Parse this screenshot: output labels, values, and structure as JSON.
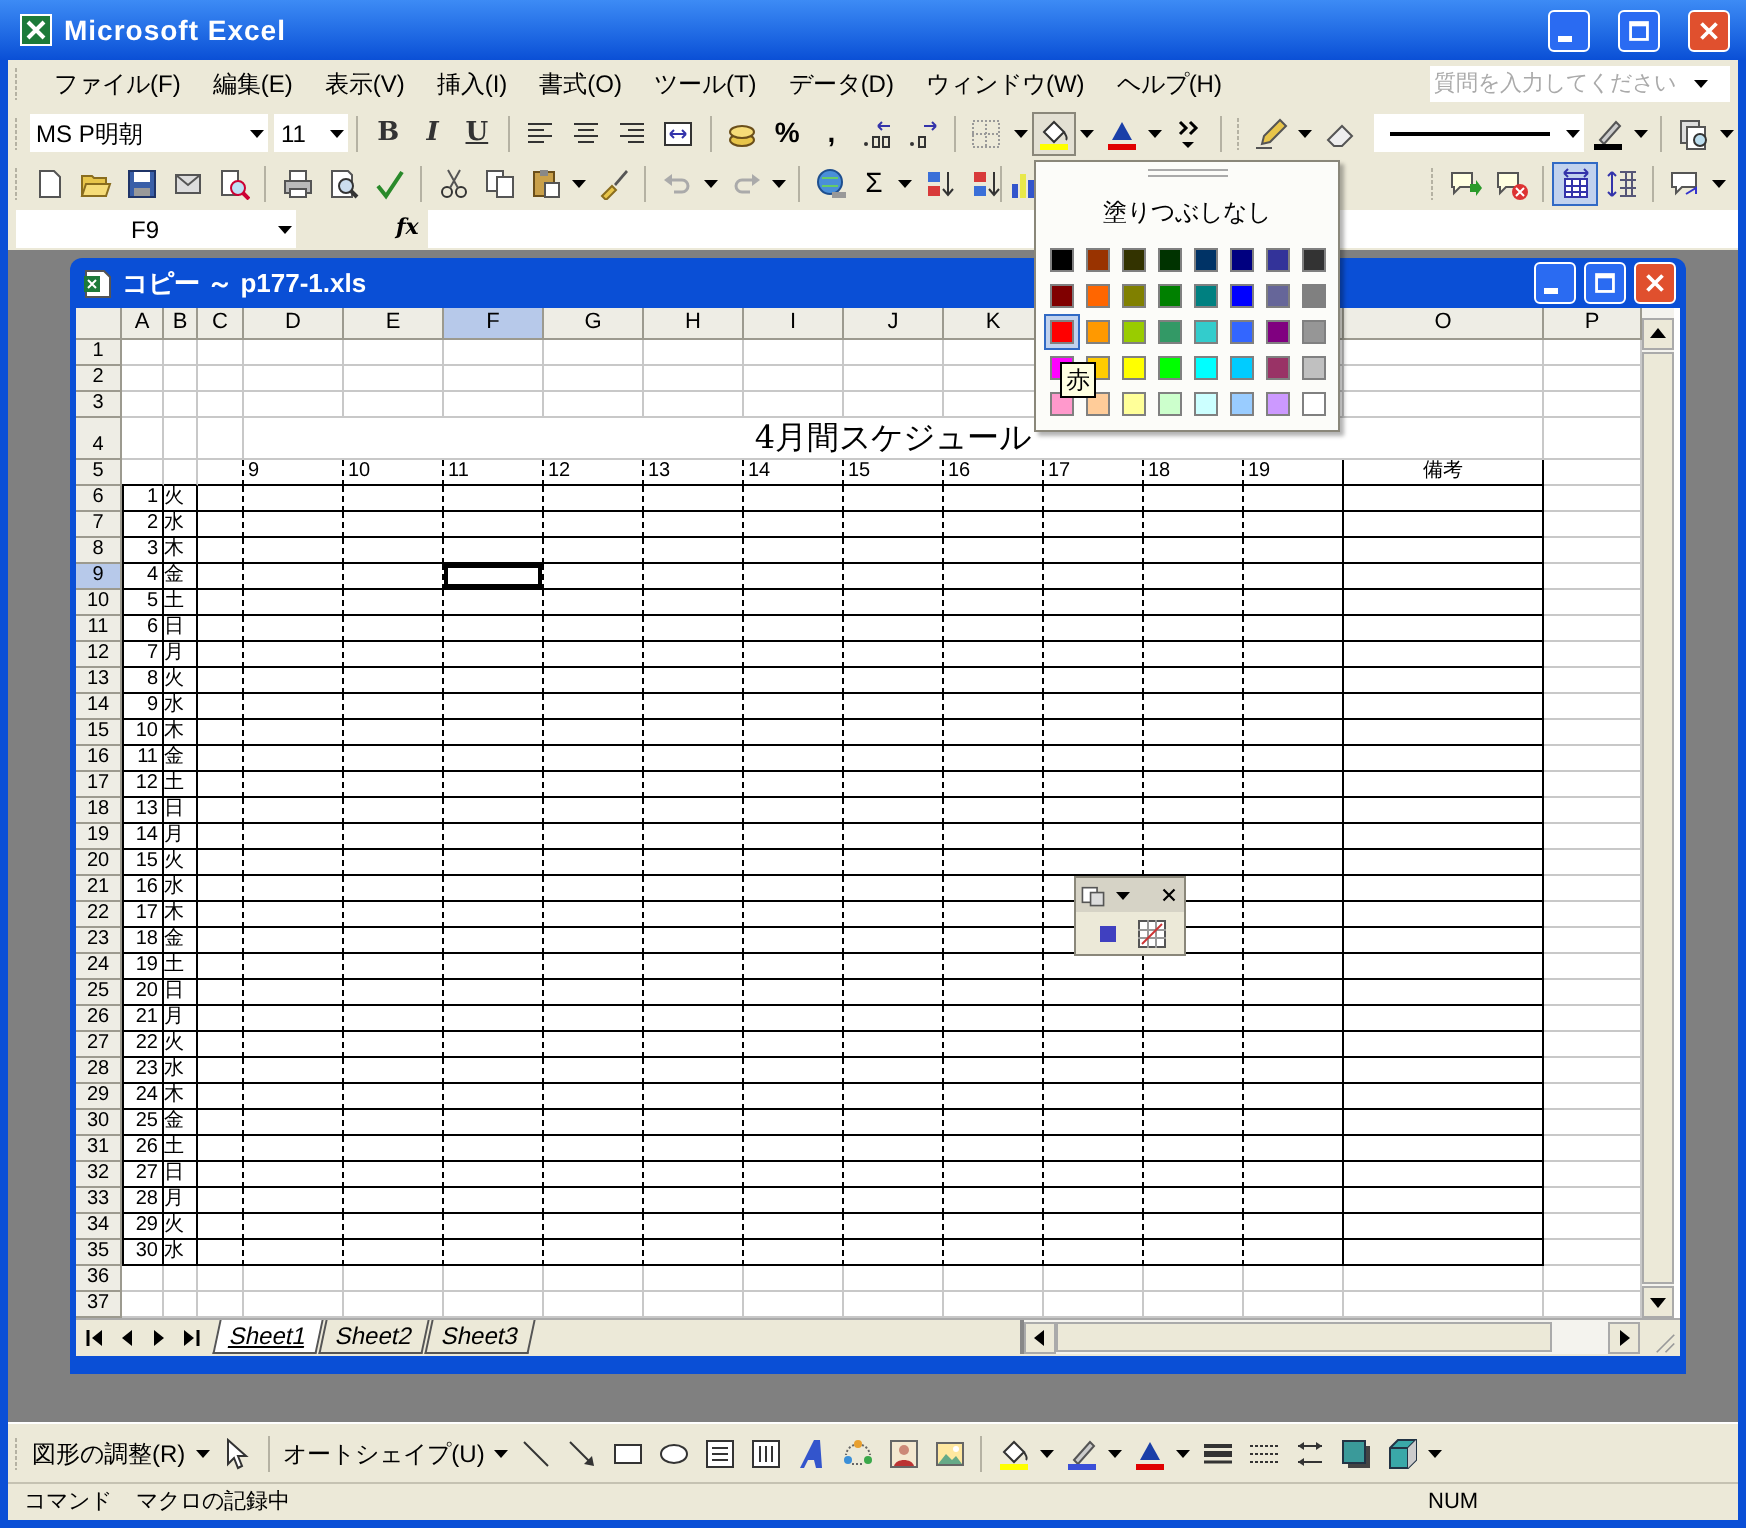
{
  "window": {
    "title": "Microsoft Excel"
  },
  "menu": [
    "ファイル(F)",
    "編集(E)",
    "表示(V)",
    "挿入(I)",
    "書式(O)",
    "ツール(T)",
    "データ(D)",
    "ウィンドウ(W)",
    "ヘルプ(H)"
  ],
  "help_search": {
    "placeholder": "質問を入力してください"
  },
  "formatting_toolbar": {
    "font": "MS P明朝",
    "size": "11",
    "style_buttons": [
      "B",
      "I",
      "U"
    ],
    "number_buttons": [
      "%",
      ","
    ]
  },
  "standard_toolbar": {
    "sum_button": "Σ"
  },
  "formula_bar": {
    "name_box": "F9",
    "function_label": "fx"
  },
  "workbook": {
    "title": "コピー ～ p177-1.xls",
    "columns": [
      {
        "label": "A",
        "selected": false
      },
      {
        "label": "B",
        "selected": false
      },
      {
        "label": "C",
        "selected": false
      },
      {
        "label": "D",
        "selected": false
      },
      {
        "label": "E",
        "selected": false
      },
      {
        "label": "F",
        "selected": true
      },
      {
        "label": "G",
        "selected": false
      },
      {
        "label": "H",
        "selected": false
      },
      {
        "label": "I",
        "selected": false
      },
      {
        "label": "J",
        "selected": false
      },
      {
        "label": "K",
        "selected": false
      },
      {
        "label": "O",
        "selected": false
      },
      {
        "label": "P",
        "selected": false
      }
    ],
    "rows": [
      {
        "label": "1",
        "selected": false
      },
      {
        "label": "2",
        "selected": false
      },
      {
        "label": "3",
        "selected": false
      },
      {
        "label": "4",
        "selected": false
      },
      {
        "label": "5",
        "selected": false
      },
      {
        "label": "6",
        "selected": false
      },
      {
        "label": "7",
        "selected": false
      },
      {
        "label": "8",
        "selected": false
      },
      {
        "label": "9",
        "selected": true
      },
      {
        "label": "10",
        "selected": false
      },
      {
        "label": "11",
        "selected": false
      },
      {
        "label": "12",
        "selected": false
      },
      {
        "label": "13",
        "selected": false
      },
      {
        "label": "14",
        "selected": false
      },
      {
        "label": "15",
        "selected": false
      },
      {
        "label": "16",
        "selected": false
      },
      {
        "label": "17",
        "selected": false
      },
      {
        "label": "18",
        "selected": false
      },
      {
        "label": "19",
        "selected": false
      },
      {
        "label": "20",
        "selected": false
      },
      {
        "label": "21",
        "selected": false
      },
      {
        "label": "22",
        "selected": false
      },
      {
        "label": "23",
        "selected": false
      },
      {
        "label": "24",
        "selected": false
      },
      {
        "label": "25",
        "selected": false
      },
      {
        "label": "26",
        "selected": false
      },
      {
        "label": "27",
        "selected": false
      },
      {
        "label": "28",
        "selected": false
      },
      {
        "label": "29",
        "selected": false
      },
      {
        "label": "30",
        "selected": false
      },
      {
        "label": "31",
        "selected": false
      },
      {
        "label": "32",
        "selected": false
      },
      {
        "label": "33",
        "selected": false
      },
      {
        "label": "34",
        "selected": false
      },
      {
        "label": "35",
        "selected": false
      },
      {
        "label": "36",
        "selected": false
      },
      {
        "label": "37",
        "selected": false
      }
    ],
    "title_cell": "4月間スケジュール",
    "hours": [
      "9",
      "10",
      "11",
      "12",
      "13",
      "14",
      "15",
      "16",
      "17",
      "18",
      "19"
    ],
    "notes_header": "備考",
    "days": [
      {
        "day": "1",
        "weekday": "火"
      },
      {
        "day": "2",
        "weekday": "水"
      },
      {
        "day": "3",
        "weekday": "木"
      },
      {
        "day": "4",
        "weekday": "金"
      },
      {
        "day": "5",
        "weekday": "土"
      },
      {
        "day": "6",
        "weekday": "日"
      },
      {
        "day": "7",
        "weekday": "月"
      },
      {
        "day": "8",
        "weekday": "火"
      },
      {
        "day": "9",
        "weekday": "水"
      },
      {
        "day": "10",
        "weekday": "木"
      },
      {
        "day": "11",
        "weekday": "金"
      },
      {
        "day": "12",
        "weekday": "土"
      },
      {
        "day": "13",
        "weekday": "日"
      },
      {
        "day": "14",
        "weekday": "月"
      },
      {
        "day": "15",
        "weekday": "火"
      },
      {
        "day": "16",
        "weekday": "水"
      },
      {
        "day": "17",
        "weekday": "木"
      },
      {
        "day": "18",
        "weekday": "金"
      },
      {
        "day": "19",
        "weekday": "土"
      },
      {
        "day": "20",
        "weekday": "日"
      },
      {
        "day": "21",
        "weekday": "月"
      },
      {
        "day": "22",
        "weekday": "火"
      },
      {
        "day": "23",
        "weekday": "水"
      },
      {
        "day": "24",
        "weekday": "木"
      },
      {
        "day": "25",
        "weekday": "金"
      },
      {
        "day": "26",
        "weekday": "土"
      },
      {
        "day": "27",
        "weekday": "日"
      },
      {
        "day": "28",
        "weekday": "月"
      },
      {
        "day": "29",
        "weekday": "火"
      },
      {
        "day": "30",
        "weekday": "水"
      }
    ],
    "sheet_tabs": [
      {
        "label": "Sheet1",
        "selected": true
      },
      {
        "label": "Sheet2",
        "selected": false
      },
      {
        "label": "Sheet3",
        "selected": false
      }
    ]
  },
  "fill_color_menu": {
    "no_fill": "塗りつぶしなし",
    "tooltip": "赤",
    "colors": [
      {
        "color": "#000000",
        "selected": false
      },
      {
        "color": "#993300",
        "selected": false
      },
      {
        "color": "#333300",
        "selected": false
      },
      {
        "color": "#003300",
        "selected": false
      },
      {
        "color": "#003366",
        "selected": false
      },
      {
        "color": "#000080",
        "selected": false
      },
      {
        "color": "#333399",
        "selected": false
      },
      {
        "color": "#333333",
        "selected": false
      },
      {
        "color": "#800000",
        "selected": false
      },
      {
        "color": "#ff6600",
        "selected": false
      },
      {
        "color": "#808000",
        "selected": false
      },
      {
        "color": "#008000",
        "selected": false
      },
      {
        "color": "#008080",
        "selected": false
      },
      {
        "color": "#0000ff",
        "selected": false
      },
      {
        "color": "#666699",
        "selected": false
      },
      {
        "color": "#808080",
        "selected": false
      },
      {
        "color": "#ff0000",
        "selected": true
      },
      {
        "color": "#ff9900",
        "selected": false
      },
      {
        "color": "#99cc00",
        "selected": false
      },
      {
        "color": "#339966",
        "selected": false
      },
      {
        "color": "#33cccc",
        "selected": false
      },
      {
        "color": "#3366ff",
        "selected": false
      },
      {
        "color": "#800080",
        "selected": false
      },
      {
        "color": "#969696",
        "selected": false
      },
      {
        "color": "#ff00ff",
        "selected": false
      },
      {
        "color": "#ffcc00",
        "selected": false
      },
      {
        "color": "#ffff00",
        "selected": false
      },
      {
        "color": "#00ff00",
        "selected": false
      },
      {
        "color": "#00ffff",
        "selected": false
      },
      {
        "color": "#00ccff",
        "selected": false
      },
      {
        "color": "#993366",
        "selected": false
      },
      {
        "color": "#c0c0c0",
        "selected": false
      },
      {
        "color": "#ff99cc",
        "selected": false
      },
      {
        "color": "#ffcc99",
        "selected": false
      },
      {
        "color": "#ffff99",
        "selected": false
      },
      {
        "color": "#ccffcc",
        "selected": false
      },
      {
        "color": "#ccffff",
        "selected": false
      },
      {
        "color": "#99ccff",
        "selected": false
      },
      {
        "color": "#cc99ff",
        "selected": false
      },
      {
        "color": "#ffffff",
        "selected": false
      }
    ]
  },
  "drawing_toolbar": {
    "draw_menu": "図形の調整(R)",
    "autoshapes_menu": "オートシェイプ(U)"
  },
  "status_bar": {
    "mode": "コマンド",
    "macro": "マクロの記録中",
    "num_lock": "NUM"
  }
}
